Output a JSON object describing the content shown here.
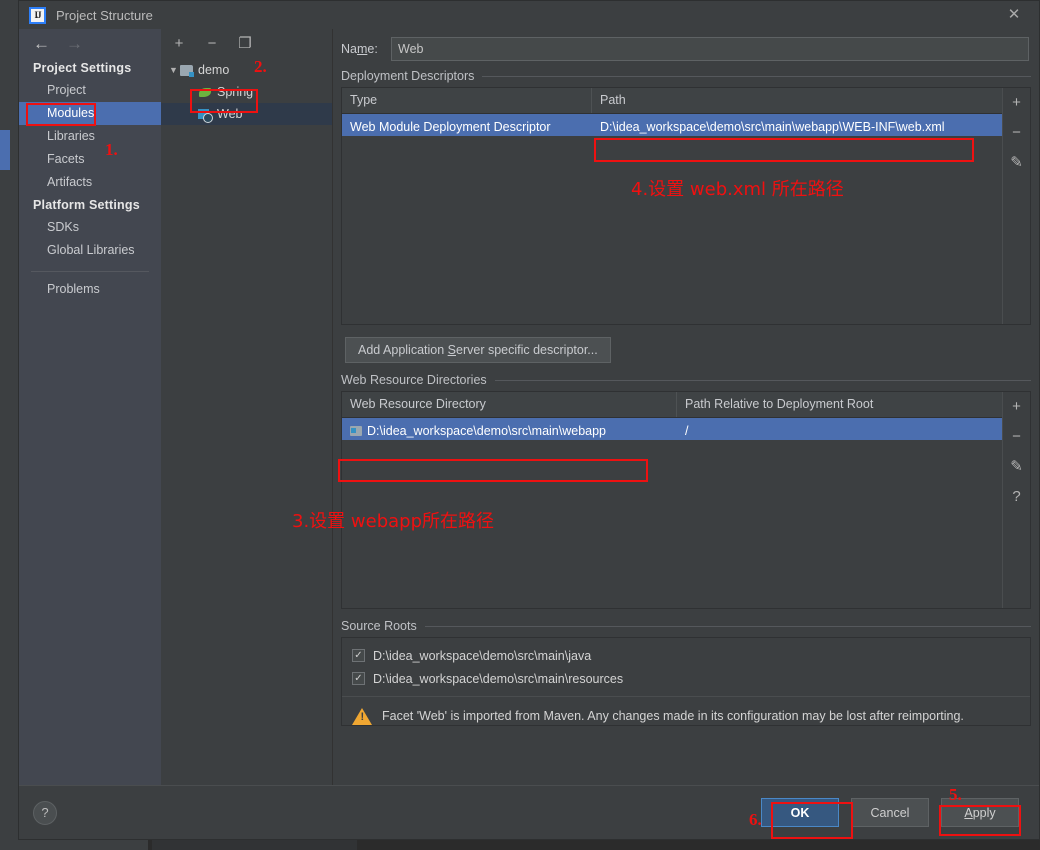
{
  "window": {
    "title": "Project Structure",
    "logo_text": "IJ",
    "close_icon": "close-icon"
  },
  "leftnav": {
    "back_icon": "←",
    "forward_icon": "→",
    "groups": [
      {
        "title": "Project Settings",
        "items": [
          {
            "label": "Project",
            "selected": false
          },
          {
            "label": "Modules",
            "selected": true
          },
          {
            "label": "Libraries",
            "selected": false
          },
          {
            "label": "Facets",
            "selected": false
          },
          {
            "label": "Artifacts",
            "selected": false
          }
        ]
      },
      {
        "title": "Platform Settings",
        "items": [
          {
            "label": "SDKs",
            "selected": false
          },
          {
            "label": "Global Libraries",
            "selected": false
          }
        ]
      }
    ],
    "problems": "Problems"
  },
  "tree": {
    "toolbar": [
      {
        "name": "add-module-button",
        "glyph": "+"
      },
      {
        "name": "remove-module-button",
        "glyph": "−"
      },
      {
        "name": "copy-module-button",
        "glyph": "❐"
      }
    ],
    "nodes": [
      {
        "label": "demo",
        "icon": "folder-module-icon",
        "twisty": "▼",
        "depth": 0,
        "selected": false
      },
      {
        "label": "Spring",
        "icon": "spring-facet-icon",
        "twisty": "",
        "depth": 1,
        "selected": false
      },
      {
        "label": "Web",
        "icon": "web-facet-icon",
        "twisty": "",
        "depth": 1,
        "selected": true
      }
    ]
  },
  "content": {
    "name_label_pre": "Na",
    "name_label_u": "m",
    "name_label_post": "e:",
    "name_value": "Web",
    "deployment": {
      "title": "Deployment Descriptors",
      "columns": [
        "Type",
        "Path"
      ],
      "rows": [
        {
          "type": "Web Module Deployment Descriptor",
          "path": "D:\\idea_workspace\\demo\\src\\main\\webapp\\WEB-INF\\web.xml",
          "selected": true
        }
      ],
      "tools": [
        {
          "name": "add-descriptor-button",
          "glyph": "+"
        },
        {
          "name": "remove-descriptor-button",
          "glyph": "−"
        },
        {
          "name": "edit-descriptor-button",
          "glyph": "✎"
        }
      ]
    },
    "add_descriptor_button": {
      "pre": "Add Application ",
      "u": "S",
      "post": "erver specific descriptor..."
    },
    "web_resources": {
      "title": "Web Resource Directories",
      "columns": [
        "Web Resource Directory",
        "Path Relative to Deployment Root"
      ],
      "rows": [
        {
          "directory": "D:\\idea_workspace\\demo\\src\\main\\webapp",
          "relative": "/",
          "selected": true
        }
      ],
      "tools": [
        {
          "name": "add-web-resource-button",
          "glyph": "+"
        },
        {
          "name": "remove-web-resource-button",
          "glyph": "−"
        },
        {
          "name": "edit-web-resource-button",
          "glyph": "✎"
        },
        {
          "name": "help-web-resource-button",
          "glyph": "?"
        }
      ]
    },
    "source_roots": {
      "title": "Source Roots",
      "items": [
        {
          "label": "D:\\idea_workspace\\demo\\src\\main\\java",
          "checked": true
        },
        {
          "label": "D:\\idea_workspace\\demo\\src\\main\\resources",
          "checked": true
        }
      ]
    },
    "warning": {
      "icon": "warning-triangle-icon",
      "text": "Facet 'Web' is imported from Maven. Any changes made in its configuration may be lost after reimporting."
    }
  },
  "footer": {
    "help_glyph": "?",
    "ok": "OK",
    "cancel": "Cancel",
    "apply_u": "A",
    "apply_rest": "pply"
  },
  "annotations": {
    "marker_1": "1.",
    "marker_2": "2.",
    "marker_3": "3.设置 webapp所在路径",
    "marker_4": "4.设置 web.xml 所在路径",
    "marker_5": "5.",
    "marker_6": "6.",
    "color": "#f01010"
  }
}
